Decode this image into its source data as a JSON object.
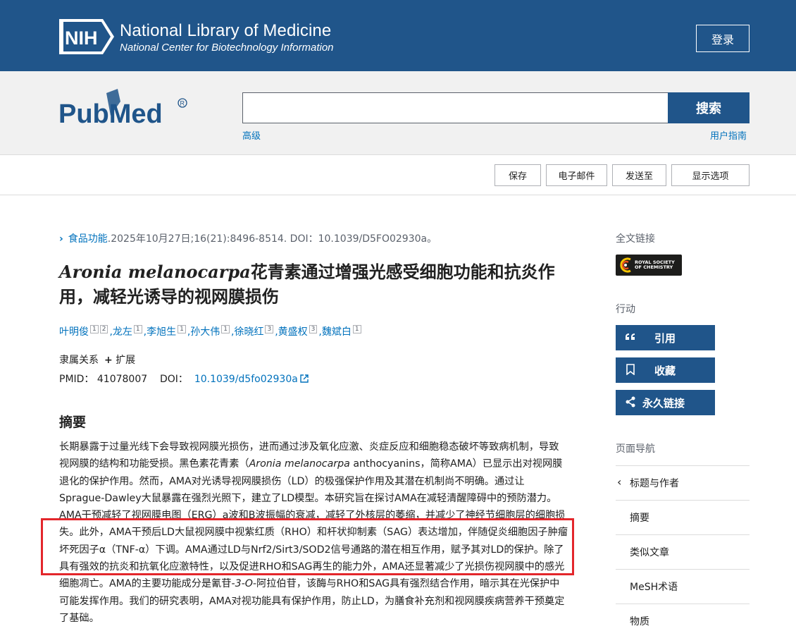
{
  "header": {
    "logo_text": "NIH",
    "title": "National Library of Medicine",
    "subtitle": "National Center for Biotechnology Information",
    "login_label": "登录"
  },
  "search": {
    "logo_text": "PubMed",
    "button_label": "搜索",
    "advanced_label": "高级",
    "guide_label": "用户指南",
    "value": ""
  },
  "actions": {
    "save": "保存",
    "email": "电子邮件",
    "send_to": "发送至",
    "display_options": "显示选项"
  },
  "article": {
    "journal": "食品功能",
    "citation": ".2025年10月27日;16(21):8496-8514. DOI：10.1039/D5FO02930a。",
    "title_italic": "Aronia melanocarpa",
    "title_rest": "花青素通过增强光感受细胞功能和抗炎作用，减轻光诱导的视网膜损伤",
    "authors": [
      {
        "name": "叶明俊",
        "sup": [
          "1",
          "2"
        ]
      },
      {
        "name": "龙左",
        "sup": [
          "1"
        ]
      },
      {
        "name": "李旭生",
        "sup": [
          "1"
        ]
      },
      {
        "name": "孙大伟",
        "sup": [
          "1"
        ]
      },
      {
        "name": "徐晓红",
        "sup": [
          "3"
        ]
      },
      {
        "name": "黄盛权",
        "sup": [
          "3"
        ]
      },
      {
        "name": "魏斌白",
        "sup": [
          "1"
        ]
      }
    ],
    "affiliation_label": "隶属关系",
    "expand_label": "扩展",
    "pmid_label": "PMID：",
    "pmid": "41078007",
    "doi_label": "DOI：",
    "doi": "10.1039/d5fo02930a",
    "abstract_heading": "摘要",
    "abstract_p1": "长期暴露于过量光线下会导致视网膜光损伤，进而通过涉及氧化应激、炎症反应和细胞稳态破坏等致病机制，导致视网膜的结构和功能受损。黑色素花青素（",
    "abstract_p1_italic": "Aronia melanocarpa",
    "abstract_p2": " anthocyanins，简称AMA）已显示出对视网膜退化的保护作用。然而，AMA对光诱导视网膜损伤（LD）的极强保护作用及其潜在机制尚不明确。通过让Sprague-Dawley大鼠暴露在强烈光照下，建立了LD模型。本研究旨在探讨AMA在减轻清醒障碍中的预防潜力。AMA干预减轻了视网膜电图（ERG）a波和B波振幅的衰减，减轻了外核层的萎缩，并减少了神经节细胞层的细胞损失。此外，AMA干预后LD大鼠视网膜中视紫红质（RHO）和杆状抑制素（SAG）表达增加，伴随促炎细胞因子肿瘤坏死因子α（TNF-α）下调。AMA通过LD与Nrf2/Sirt3/SOD2信号通路的潜在相互作用，赋予其对LD的保护。除了具有强效的抗炎和抗氧化应激特性，以及促进RHO和SAG再生的能力外，AMA还显著减少了光损伤视网膜中的感光细胞凋亡。AMA的主要功能成分是氰苷-",
    "abstract_p2_italic": "3-O-",
    "abstract_p3": "阿拉伯苷，该酶与RHO和SAG具有强烈结合作用，暗示其在光保护中可能发挥作用。我们的研究表明，AMA对视功能具有保护作用，防止LD，为膳食补充剂和视网膜疾病营养干预奠定了基础。"
  },
  "sidebar": {
    "fulltext_label": "全文链接",
    "rsc_line1": "ROYAL SOCIETY",
    "rsc_line2": "OF CHEMISTRY",
    "actions_label": "行动",
    "cite": "引用",
    "collect": "收藏",
    "permalink": "永久链接",
    "page_nav_label": "页面导航",
    "nav": [
      "标题与作者",
      "摘要",
      "类似文章",
      "MeSH术语",
      "物质"
    ]
  },
  "colors": {
    "nih_blue": "#20558a",
    "link_blue": "#0071bc",
    "highlight_red": "#e3262b"
  }
}
